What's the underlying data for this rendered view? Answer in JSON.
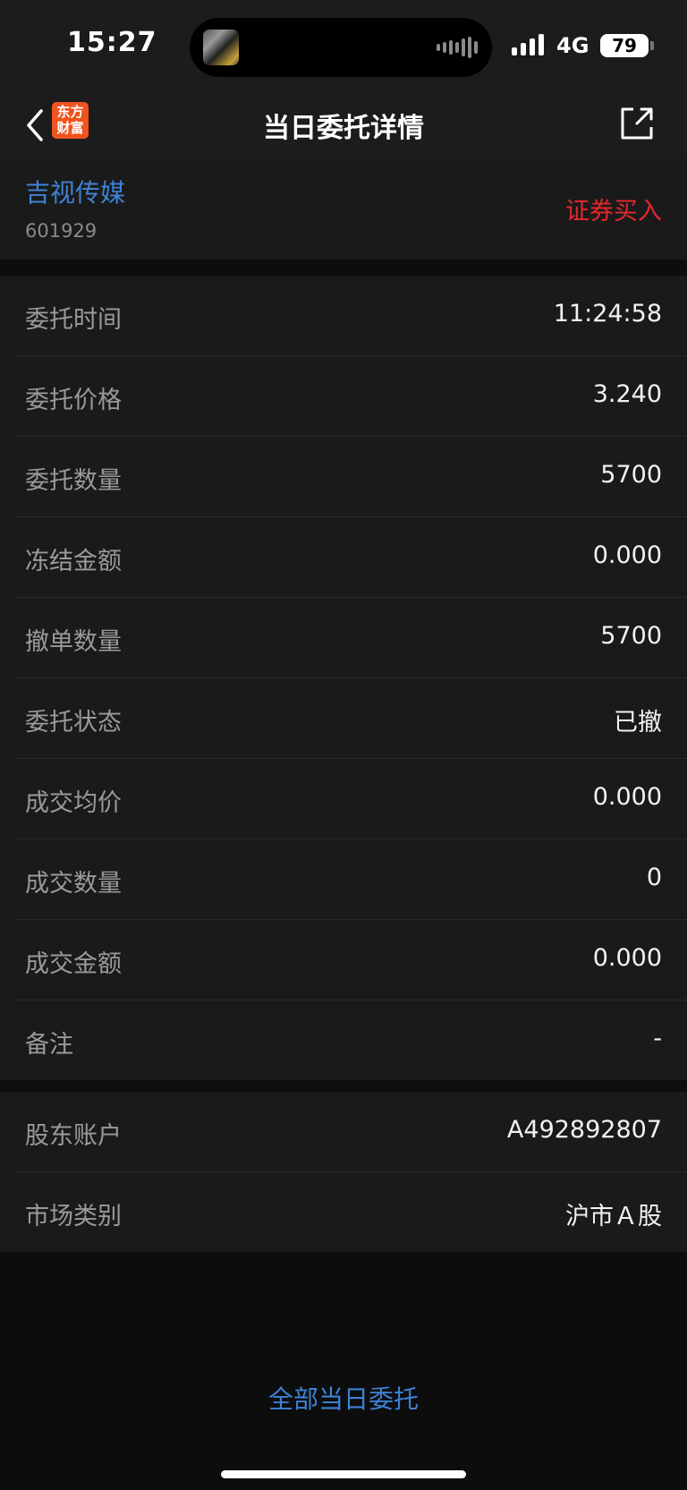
{
  "status_bar": {
    "time": "15:27",
    "network": "4G",
    "battery": "79"
  },
  "nav": {
    "title": "当日委托详情",
    "logo_line1": "东方",
    "logo_line2": "财富"
  },
  "stock": {
    "name": "吉视传媒",
    "code": "601929",
    "side": "证券买入"
  },
  "details": [
    {
      "label": "委托时间",
      "value": "11:24:58"
    },
    {
      "label": "委托价格",
      "value": "3.240"
    },
    {
      "label": "委托数量",
      "value": "5700"
    },
    {
      "label": "冻结金额",
      "value": "0.000"
    },
    {
      "label": "撤单数量",
      "value": "5700"
    },
    {
      "label": "委托状态",
      "value": "已撤"
    },
    {
      "label": "成交均价",
      "value": "0.000"
    },
    {
      "label": "成交数量",
      "value": "0"
    },
    {
      "label": "成交金额",
      "value": "0.000"
    },
    {
      "label": "备注",
      "value": "-"
    }
  ],
  "account": [
    {
      "label": "股东账户",
      "value": "A492892807"
    },
    {
      "label": "市场类别",
      "value": "沪市Ａ股"
    }
  ],
  "footer": {
    "link": "全部当日委托"
  },
  "colors": {
    "accent_blue": "#3d82d6",
    "buy_red": "#e8262b",
    "brand_orange": "#f0531d"
  }
}
